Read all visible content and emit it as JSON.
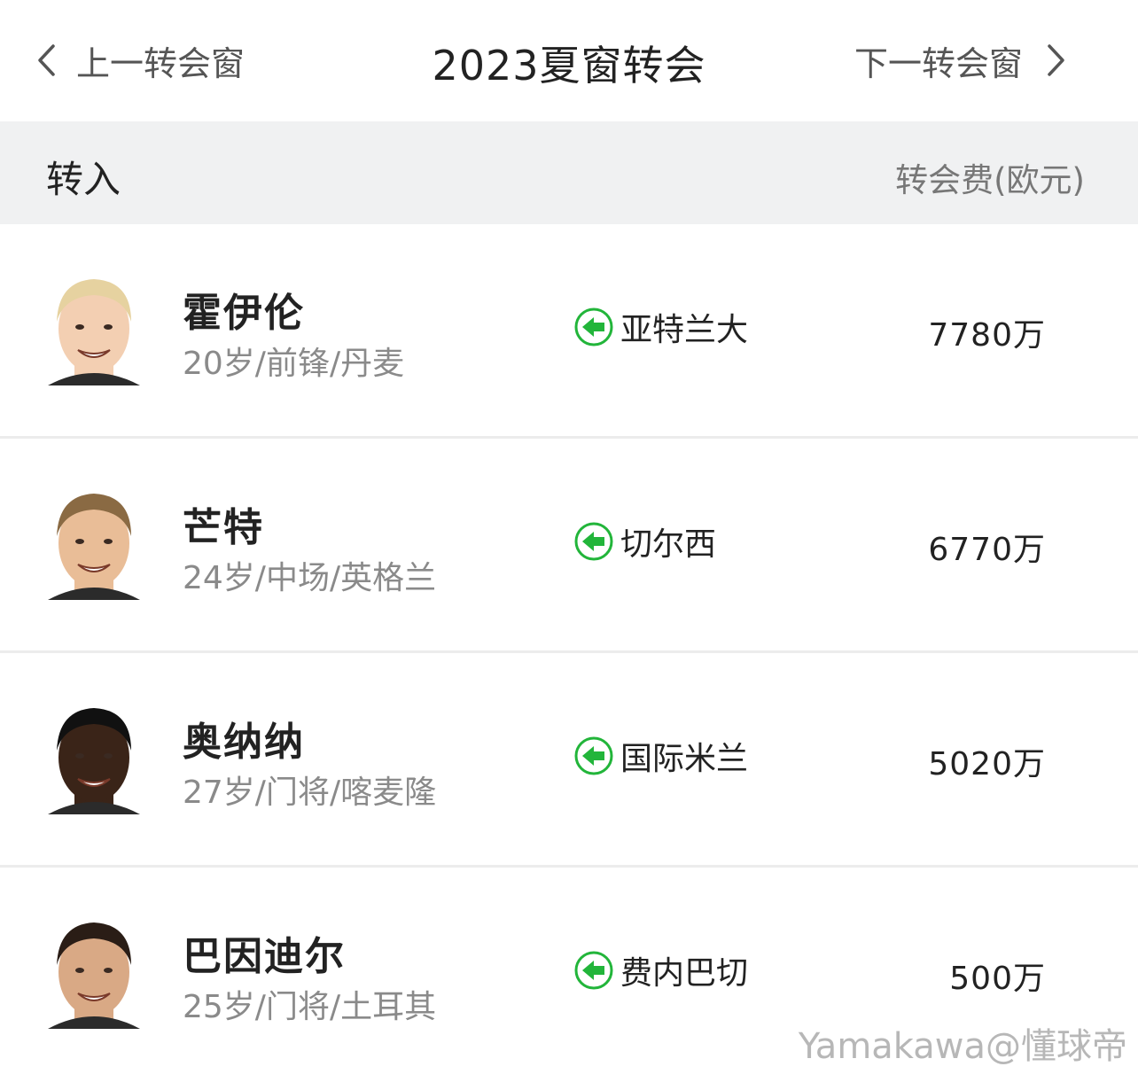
{
  "header": {
    "prev_label": "上一转会窗",
    "title": "2023夏窗转会",
    "next_label": "下一转会窗"
  },
  "section": {
    "title": "转入",
    "fee_header": "转会费(欧元)"
  },
  "transfers": [
    {
      "name": "霍伊伦",
      "meta": "20岁/前锋/丹麦",
      "from_club": "亚特兰大",
      "fee": "7780万",
      "hair": "#e6d2a0",
      "skin": "#f3cfb2"
    },
    {
      "name": "芒特",
      "meta": "24岁/中场/英格兰",
      "from_club": "切尔西",
      "fee": "6770万",
      "hair": "#8a6a43",
      "skin": "#e9bd97"
    },
    {
      "name": "奥纳纳",
      "meta": "27岁/门将/喀麦隆",
      "from_club": "国际米兰",
      "fee": "5020万",
      "hair": "#111111",
      "skin": "#3a2418"
    },
    {
      "name": "巴因迪尔",
      "meta": "25岁/门将/土耳其",
      "from_club": "费内巴切",
      "fee": "500万",
      "hair": "#2a1d16",
      "skin": "#d9a985"
    }
  ],
  "colors": {
    "arrow_green": "#22b53a",
    "header_bg": "#f0f1f2"
  },
  "watermark": "Yamakawa@懂球帝"
}
